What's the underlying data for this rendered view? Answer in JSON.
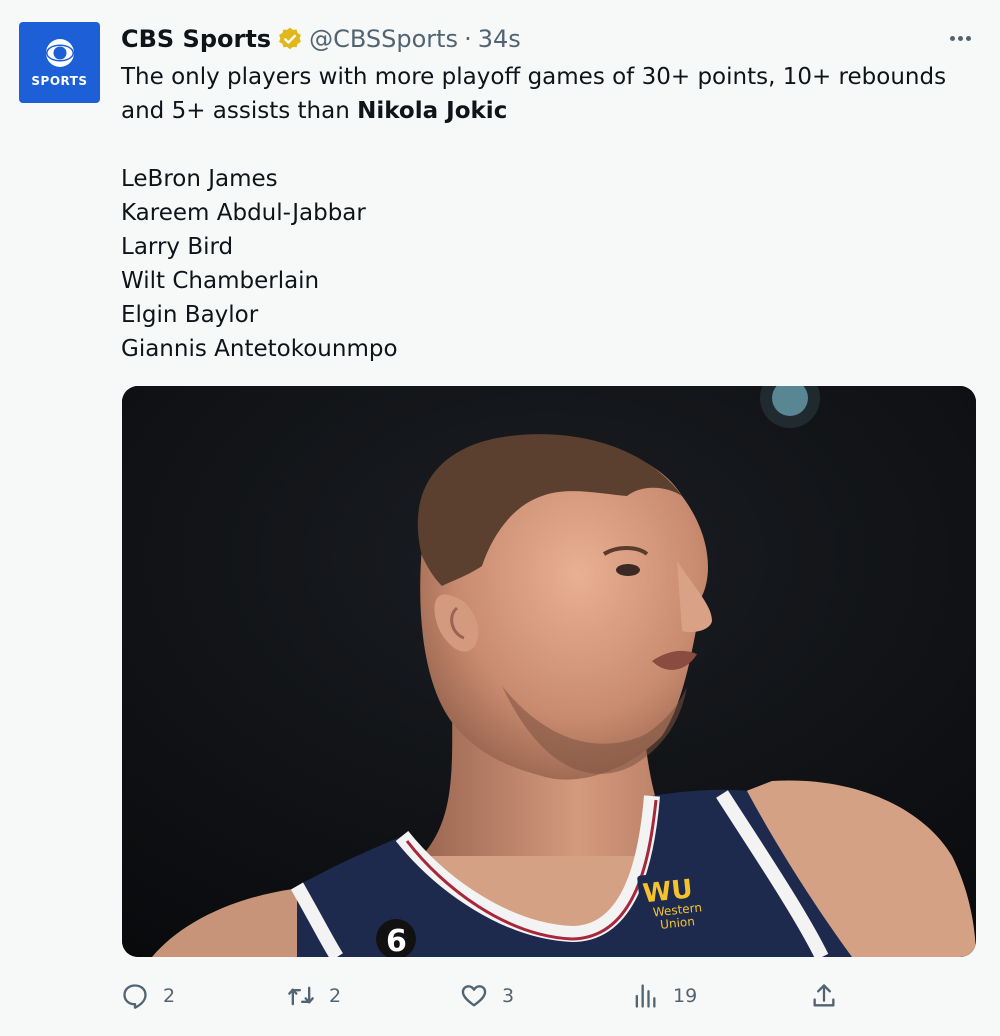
{
  "author": {
    "name": "CBS Sports",
    "handle": "@CBSSports",
    "separator": "·",
    "time": "34s",
    "avatar_text": "SPORTS",
    "verified_icon": "gold-verified-badge-icon"
  },
  "tweet": {
    "intro": "The only players with more playoff games of 30+ points, 10+ rebounds and 5+ assists than ",
    "highlight": "Nikola Jokic",
    "players": [
      "LeBron James",
      "Kareem Abdul-Jabbar",
      "Larry Bird",
      "Wilt Chamberlain",
      "Elgin Baylor",
      "Giannis Antetokounmpo"
    ]
  },
  "media": {
    "jersey_logo_text": "WU",
    "jersey_logo_subtext_1": "Western",
    "jersey_logo_subtext_2": "Union",
    "jersey_number": "6"
  },
  "actions": {
    "reply": {
      "icon": "reply-icon",
      "count": "2"
    },
    "retweet": {
      "icon": "retweet-icon",
      "count": "2"
    },
    "like": {
      "icon": "heart-icon",
      "count": "3"
    },
    "views": {
      "icon": "analytics-icon",
      "count": "19"
    },
    "share": {
      "icon": "share-icon"
    }
  },
  "colors": {
    "background": "#f7f9f9",
    "text": "#0f1419",
    "muted": "#536471",
    "avatar_blue": "#1d5fd6",
    "verified_gold": "#e2b719",
    "jersey_navy": "#1d2a4e"
  }
}
